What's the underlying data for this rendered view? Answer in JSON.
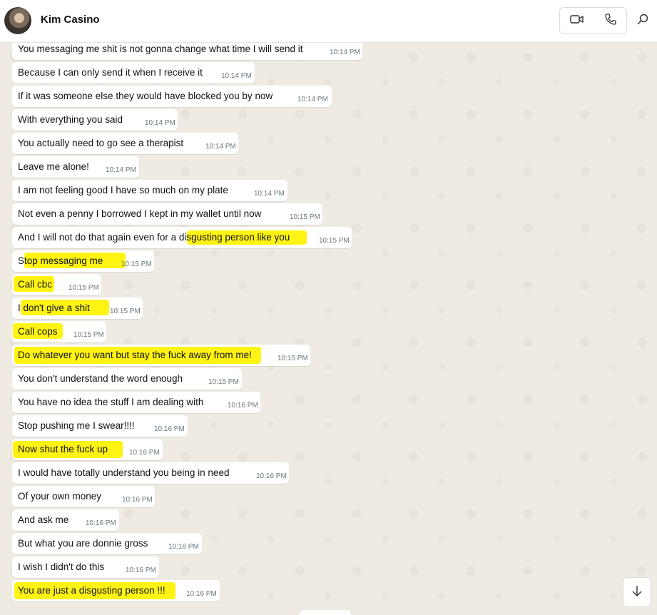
{
  "header": {
    "contact_name": "Kim Casino"
  },
  "icons": {
    "video": "video-camera-icon",
    "voice": "phone-icon",
    "search": "search-icon",
    "scroll": "arrow-down-icon"
  },
  "colors": {
    "highlight": "#fff200",
    "bubble": "#ffffff",
    "chat_bg": "#efeae2"
  },
  "messages": [
    {
      "text": "You messaging me shit is not gonna change what time I will send it",
      "time": "10:14 PM"
    },
    {
      "text": "Because I can only send it when I receive it",
      "time": "10:14 PM"
    },
    {
      "text": "If it was someone else they would have blocked you by now",
      "time": "10:14 PM"
    },
    {
      "text": "With everything you said",
      "time": "10:14 PM"
    },
    {
      "text": "You actually need to go see a therapist",
      "time": "10:14 PM"
    },
    {
      "text": "Leave me alone!",
      "time": "10:14 PM"
    },
    {
      "text": "I am not feeling good I have so much on my plate",
      "time": "10:14 PM"
    },
    {
      "text": "Not even a penny I borrowed I kept in my wallet until now",
      "time": "10:15 PM"
    },
    {
      "text": "And I will not do that again even for a disgusting person like you",
      "time": "10:15 PM"
    },
    {
      "text": "Stop messaging me",
      "time": "10:15 PM"
    },
    {
      "text": "Call cbc",
      "time": "10:15 PM"
    },
    {
      "text": "I don't give a shit",
      "time": "10:15 PM"
    },
    {
      "text": "Call cops",
      "time": "10:15 PM"
    },
    {
      "text": "Do whatever you want but stay the fuck away from me!",
      "time": "10:15 PM"
    },
    {
      "text": "You don't understand the word enough",
      "time": "10:15 PM"
    },
    {
      "text": "You have no idea the stuff I am dealing with",
      "time": "10:16 PM"
    },
    {
      "text": "Stop pushing me I swear!!!!",
      "time": "10:16 PM"
    },
    {
      "text": "Now shut the fuck up",
      "time": "10:16 PM"
    },
    {
      "text": "I would have totally understand you being in need",
      "time": "10:16 PM"
    },
    {
      "text": "Of your own money",
      "time": "10:16 PM"
    },
    {
      "text": "And ask me",
      "time": "10:16 PM"
    },
    {
      "text": "But what you are donnie gross",
      "time": "10:16 PM"
    },
    {
      "text": "I wish I didn't do this",
      "time": "10:16 PM"
    },
    {
      "text": "You are just a disgusting person !!!",
      "time": "10:16 PM"
    }
  ]
}
